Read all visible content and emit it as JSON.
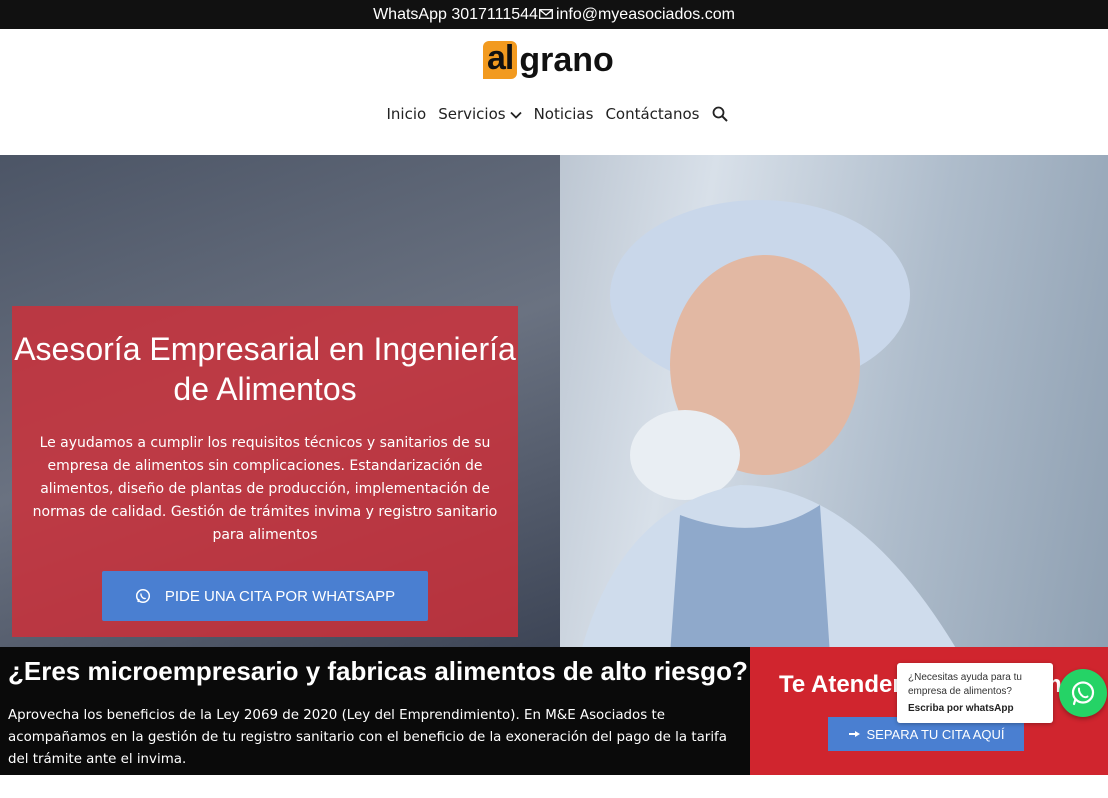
{
  "topbar": {
    "whatsapp_text": "WhatsApp 3017111544",
    "email_text": "info@myeasociados.com",
    "mail_icon": "mail-icon"
  },
  "logo": {
    "part1": "al",
    "part2": "grano",
    "accent_color": "#f29a1f"
  },
  "nav": {
    "items": [
      {
        "label": "Inicio"
      },
      {
        "label": "Servicios"
      },
      {
        "label": "Noticias"
      },
      {
        "label": "Contáctanos"
      }
    ],
    "dropdown_icon": "chevron-down-icon",
    "search_icon": "search-icon"
  },
  "hero": {
    "title": "Asesoría Empresarial en Ingeniería de Alimentos",
    "description": "Le ayudamos a cumplir los requisitos técnicos y sanitarios de su empresa de alimentos sin complicaciones. Estandarización de alimentos, diseño de plantas de producción, implementación de normas de calidad. Gestión de trámites invima y registro sanitario para alimentos",
    "cta_label": "PIDE UNA CITA POR WHATSAPP",
    "cta_icon": "whatsapp-icon",
    "card_color": "#cf2e38",
    "cta_color": "#4a7fd1"
  },
  "band": {
    "heading": "¿Eres microempresario y fabricas alimentos de alto riesgo?",
    "text": "Aprovecha los beneficios de la Ley 2069 de 2020 (Ley del Emprendimiento). En M&E Asociados te acompañamos en la gestión de tu registro sanitario con el beneficio de la exoneración del pago de la tarifa del trámite ante el invima."
  },
  "redbox": {
    "title": "Te Atendemos Hoy Mismo",
    "button_label": "SEPARA TU CITA AQUÍ",
    "button_icon": "hand-pointer-icon",
    "color": "#d0252e"
  },
  "chat_popup": {
    "line1": "¿Necesitas ayuda para tu empresa de alimentos?",
    "line2": "Escriba por whatsApp"
  },
  "floating_button": {
    "icon": "whatsapp-icon",
    "color": "#25d366"
  }
}
